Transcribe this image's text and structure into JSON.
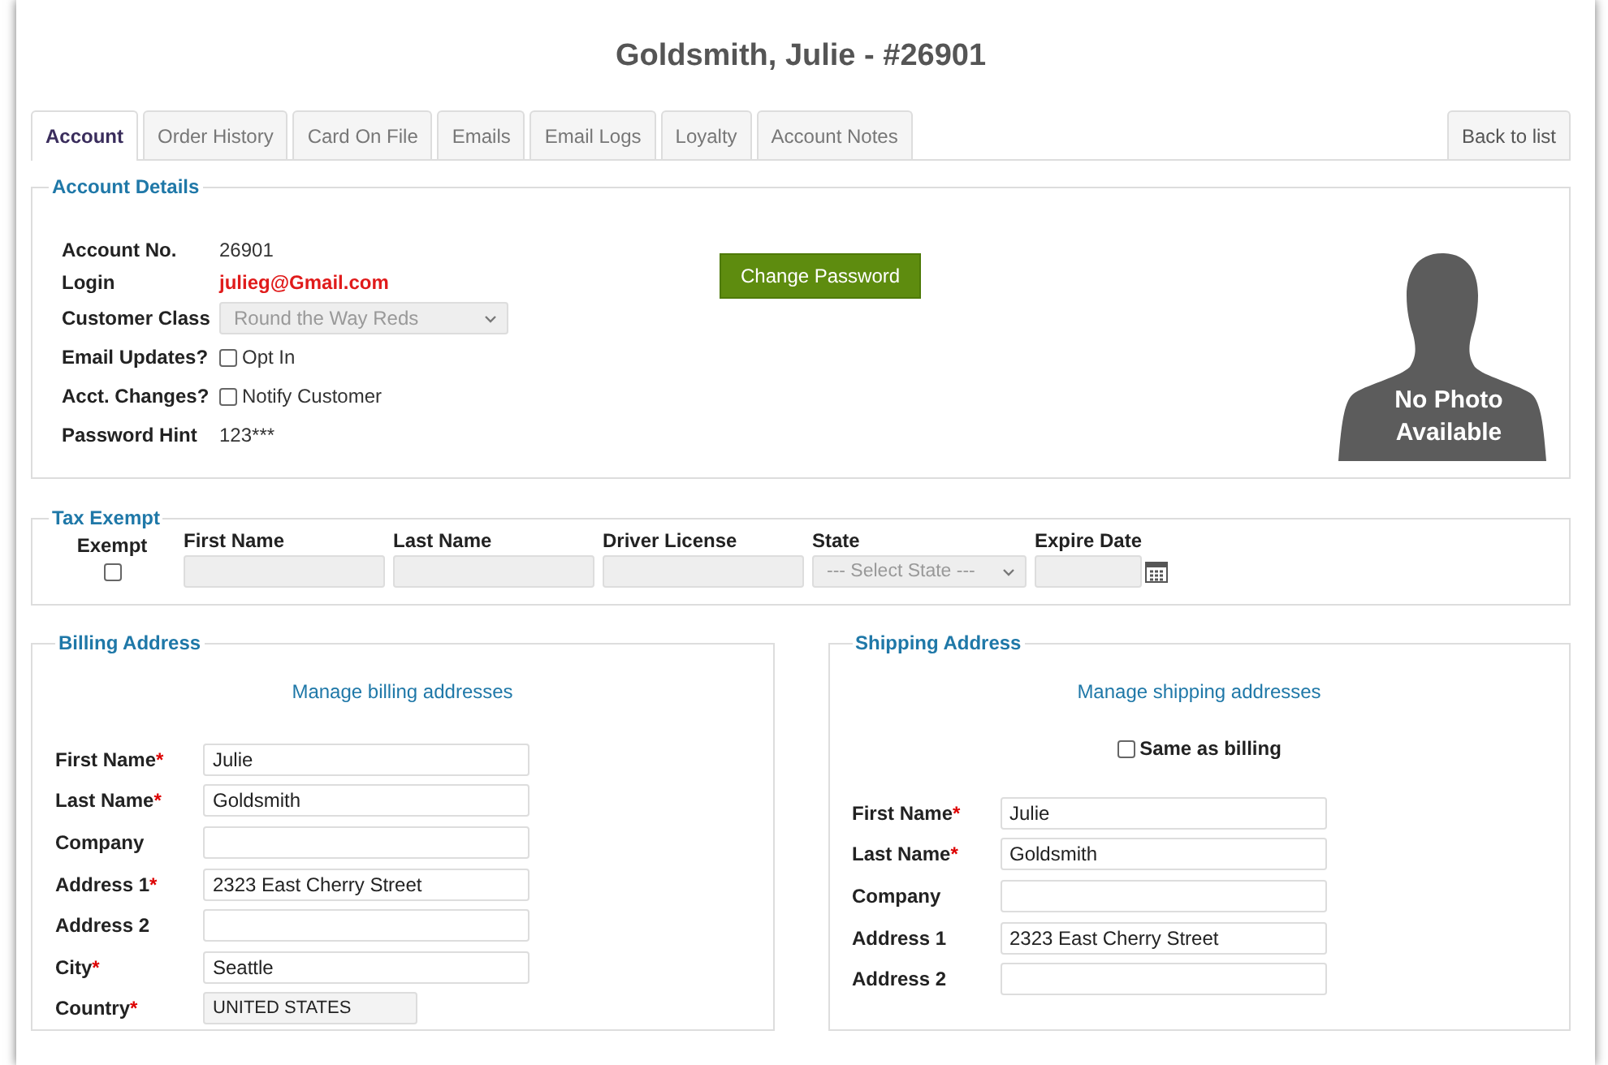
{
  "title": "Goldsmith, Julie - #26901",
  "tabs": [
    {
      "label": "Account",
      "selected": true
    },
    {
      "label": "Order History",
      "selected": false
    },
    {
      "label": "Card On File",
      "selected": false
    },
    {
      "label": "Emails",
      "selected": false
    },
    {
      "label": "Email Logs",
      "selected": false
    },
    {
      "label": "Loyalty",
      "selected": false
    },
    {
      "label": "Account Notes",
      "selected": false
    }
  ],
  "back_button": "Back to list",
  "account_details": {
    "legend": "Account Details",
    "rows": [
      {
        "label": "Account No.",
        "kind": "text",
        "value": "26901"
      },
      {
        "label": "Login",
        "kind": "email",
        "value": "julieg@Gmail.com"
      },
      {
        "label": "Customer Class",
        "kind": "select",
        "value": "Round the Way Reds",
        "disabled": true
      },
      {
        "label": "Email Updates?",
        "kind": "checkbox",
        "option": "Opt In",
        "checked": false
      },
      {
        "label": "Acct. Changes?",
        "kind": "checkbox",
        "option": "Notify Customer",
        "checked": false
      },
      {
        "label": "Password Hint",
        "kind": "text",
        "value": "123***"
      }
    ],
    "change_password_button": "Change Password",
    "photo_caption": "No Photo Available"
  },
  "tax_exempt": {
    "legend": "Tax Exempt",
    "exempt": {
      "label": "Exempt",
      "checked": false
    },
    "fields": [
      {
        "label": "First Name",
        "kind": "input",
        "disabled": true
      },
      {
        "label": "Last Name",
        "kind": "input",
        "disabled": true
      },
      {
        "label": "Driver License",
        "kind": "input",
        "disabled": true
      },
      {
        "label": "State",
        "kind": "select",
        "placeholder": "--- Select State ---",
        "disabled": true
      },
      {
        "label": "Expire Date",
        "kind": "date",
        "disabled": true
      }
    ]
  },
  "billing_address": {
    "legend": "Billing Address",
    "manage_link": "Manage billing addresses",
    "fields": [
      {
        "label": "First Name",
        "required_mark": "*",
        "value": "Julie"
      },
      {
        "label": "Last Name",
        "required_mark": "*",
        "value": "Goldsmith"
      },
      {
        "label": "Company"
      },
      {
        "label": "Address 1",
        "required_mark": "*",
        "value": "2323 East Cherry Street"
      },
      {
        "label": "Address 2"
      },
      {
        "label": "City",
        "required_mark": "*",
        "value": "Seattle"
      },
      {
        "label": "Country",
        "required_mark": "*",
        "value": "UNITED STATES",
        "kind": "select"
      }
    ]
  },
  "shipping_address": {
    "legend": "Shipping Address",
    "manage_link": "Manage shipping addresses",
    "same_as_billing": {
      "label": "Same as billing",
      "checked": false
    },
    "fields": [
      {
        "label": "First Name",
        "required_mark": "*",
        "value": "Julie"
      },
      {
        "label": "Last Name",
        "required_mark": "*",
        "value": "Goldsmith"
      },
      {
        "label": "Company"
      },
      {
        "label": "Address 1",
        "value": "2323 East Cherry Street"
      },
      {
        "label": "Address 2"
      }
    ]
  }
}
